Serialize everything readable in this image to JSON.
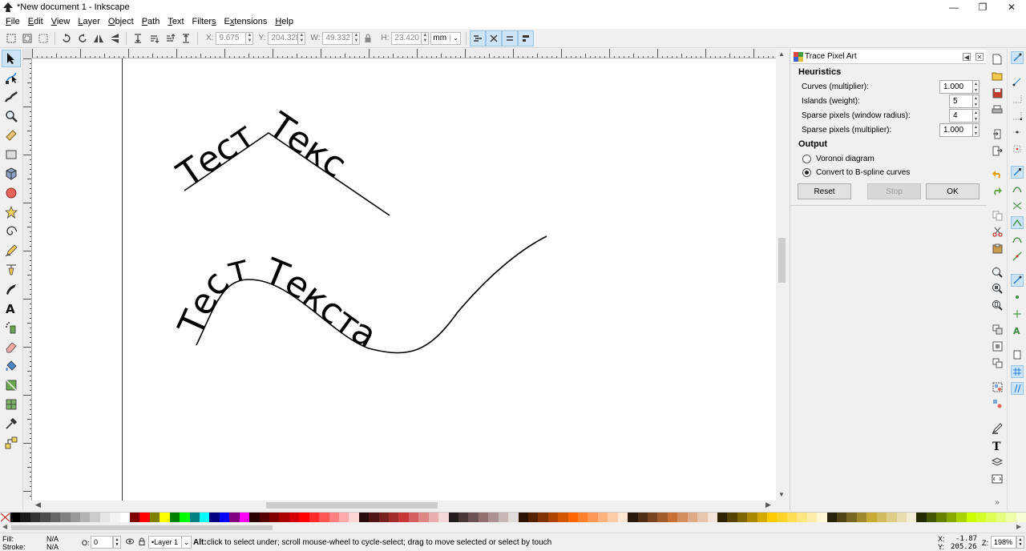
{
  "window": {
    "title": "*New document 1 - Inkscape"
  },
  "menu": [
    {
      "pre": "",
      "key": "F",
      "post": "ile"
    },
    {
      "pre": "",
      "key": "E",
      "post": "dit"
    },
    {
      "pre": "",
      "key": "V",
      "post": "iew"
    },
    {
      "pre": "",
      "key": "L",
      "post": "ayer"
    },
    {
      "pre": "",
      "key": "O",
      "post": "bject"
    },
    {
      "pre": "",
      "key": "P",
      "post": "ath"
    },
    {
      "pre": "",
      "key": "T",
      "post": "ext"
    },
    {
      "pre": "Filter",
      "key": "s",
      "post": ""
    },
    {
      "pre": "E",
      "key": "x",
      "post": "tensions"
    },
    {
      "pre": "",
      "key": "H",
      "post": "elp"
    }
  ],
  "controls": {
    "x_label": "X:",
    "x_value": "9.675",
    "y_label": "Y:",
    "y_value": "204.328",
    "w_label": "W:",
    "w_value": "49.332",
    "h_label": "H:",
    "h_value": "23.420",
    "unit": "mm"
  },
  "canvas": {
    "text_top": "Тест Текс",
    "text_bottom": "Тест Текста"
  },
  "dialog": {
    "title": "Trace Pixel Art",
    "heuristics_label": "Heuristics",
    "rows": [
      {
        "label": "Curves (multiplier):",
        "value": "1.000"
      },
      {
        "label": "Islands (weight):",
        "value": "5"
      },
      {
        "label": "Sparse pixels (window radius):",
        "value": "4"
      },
      {
        "label": "Sparse pixels (multiplier):",
        "value": "1.000"
      }
    ],
    "output_label": "Output",
    "options": [
      {
        "label": "Voronoi diagram",
        "checked": false
      },
      {
        "label": "Convert to B-spline curves",
        "checked": true
      }
    ],
    "buttons": {
      "reset": "Reset",
      "stop": "Stop",
      "ok": "OK"
    }
  },
  "status": {
    "fill_label": "Fill:",
    "fill_value": "N/A",
    "stroke_label": "Stroke:",
    "stroke_value": "N/A",
    "opacity_label": "O:",
    "opacity_value": "0",
    "layer": "•Layer 1",
    "message_key": "Alt:",
    "message": "click to select under; scroll mouse-wheel to cycle-select; drag to move selected or select by touch",
    "x_label": "X:",
    "x_value": "-1.87",
    "y_label": "Y:",
    "y_value": "205.26",
    "zoom_label": "Z:",
    "zoom_value": "198%"
  },
  "palette": [
    "#000000",
    "#1a1a1a",
    "#333333",
    "#4d4d4d",
    "#666666",
    "#808080",
    "#999999",
    "#b3b3b3",
    "#cccccc",
    "#e6e6e6",
    "#f2f2f2",
    "#ffffff",
    "#800000",
    "#ff0000",
    "#808000",
    "#ffff00",
    "#008000",
    "#00ff00",
    "#008080",
    "#00ffff",
    "#000080",
    "#0000ff",
    "#800080",
    "#ff00ff",
    "#2b0000",
    "#550000",
    "#800000",
    "#aa0000",
    "#d40000",
    "#ff0000",
    "#ff2a2a",
    "#ff5555",
    "#ff8080",
    "#ffaaaa",
    "#ffd5d5",
    "#280b0b",
    "#501616",
    "#782121",
    "#a02c2c",
    "#c83737",
    "#d35f5f",
    "#de8787",
    "#e9afaf",
    "#f4d7d7",
    "#241c1c",
    "#483737",
    "#6c5353",
    "#916f6f",
    "#ac9393",
    "#c8b7b7",
    "#e3dbdb",
    "#2b1100",
    "#552200",
    "#803300",
    "#aa4400",
    "#d45500",
    "#ff6600",
    "#ff7f2a",
    "#ff9955",
    "#ffb380",
    "#ffccaa",
    "#ffe6d5",
    "#28170b",
    "#502d16",
    "#784421",
    "#a05a2c",
    "#c87137",
    "#d38d5f",
    "#deaa87",
    "#e9c6af",
    "#f4e3d7",
    "#2b2200",
    "#554400",
    "#806600",
    "#aa8800",
    "#d4aa00",
    "#ffcc00",
    "#ffd42a",
    "#ffdd55",
    "#ffe680",
    "#ffeeaa",
    "#fff6d5",
    "#28220b",
    "#504416",
    "#786721",
    "#a0892c",
    "#c8ab37",
    "#d3bc5f",
    "#decd87",
    "#e9ddaf",
    "#f4eed7",
    "#222b00",
    "#445500",
    "#668000",
    "#88aa00",
    "#aad400",
    "#ccff00",
    "#d4ff2a",
    "#ddff55",
    "#e5ff80",
    "#eeffaa",
    "#f6ffd5"
  ]
}
